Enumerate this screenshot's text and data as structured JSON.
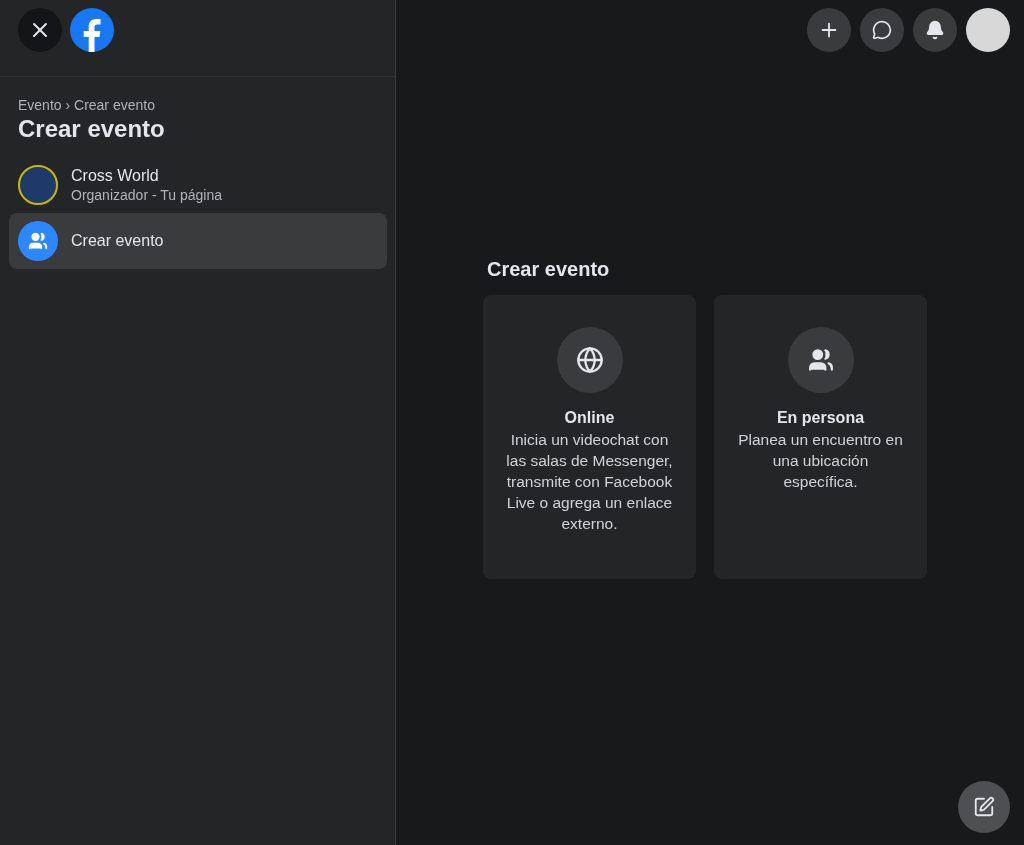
{
  "breadcrumb": "Evento › Crear evento",
  "sidebar": {
    "title": "Crear evento",
    "items": [
      {
        "kind": "page",
        "title": "Cross World",
        "subtitle": "Organizador - Tu página",
        "selected": false
      },
      {
        "kind": "action",
        "title": "Crear evento",
        "selected": true
      }
    ]
  },
  "top_actions": [
    {
      "kind": "create"
    },
    {
      "kind": "messenger"
    },
    {
      "kind": "notifications"
    },
    {
      "kind": "avatar"
    }
  ],
  "main": {
    "title": "Crear evento",
    "options": [
      {
        "kind": "online",
        "title": "Online",
        "description": "Inicia un videochat con las salas de Messenger, transmite con Facebook Live o agrega un enlace externo."
      },
      {
        "kind": "in_person",
        "title": "En persona",
        "description": "Planea un encuentro en una ubicación específica."
      }
    ]
  }
}
